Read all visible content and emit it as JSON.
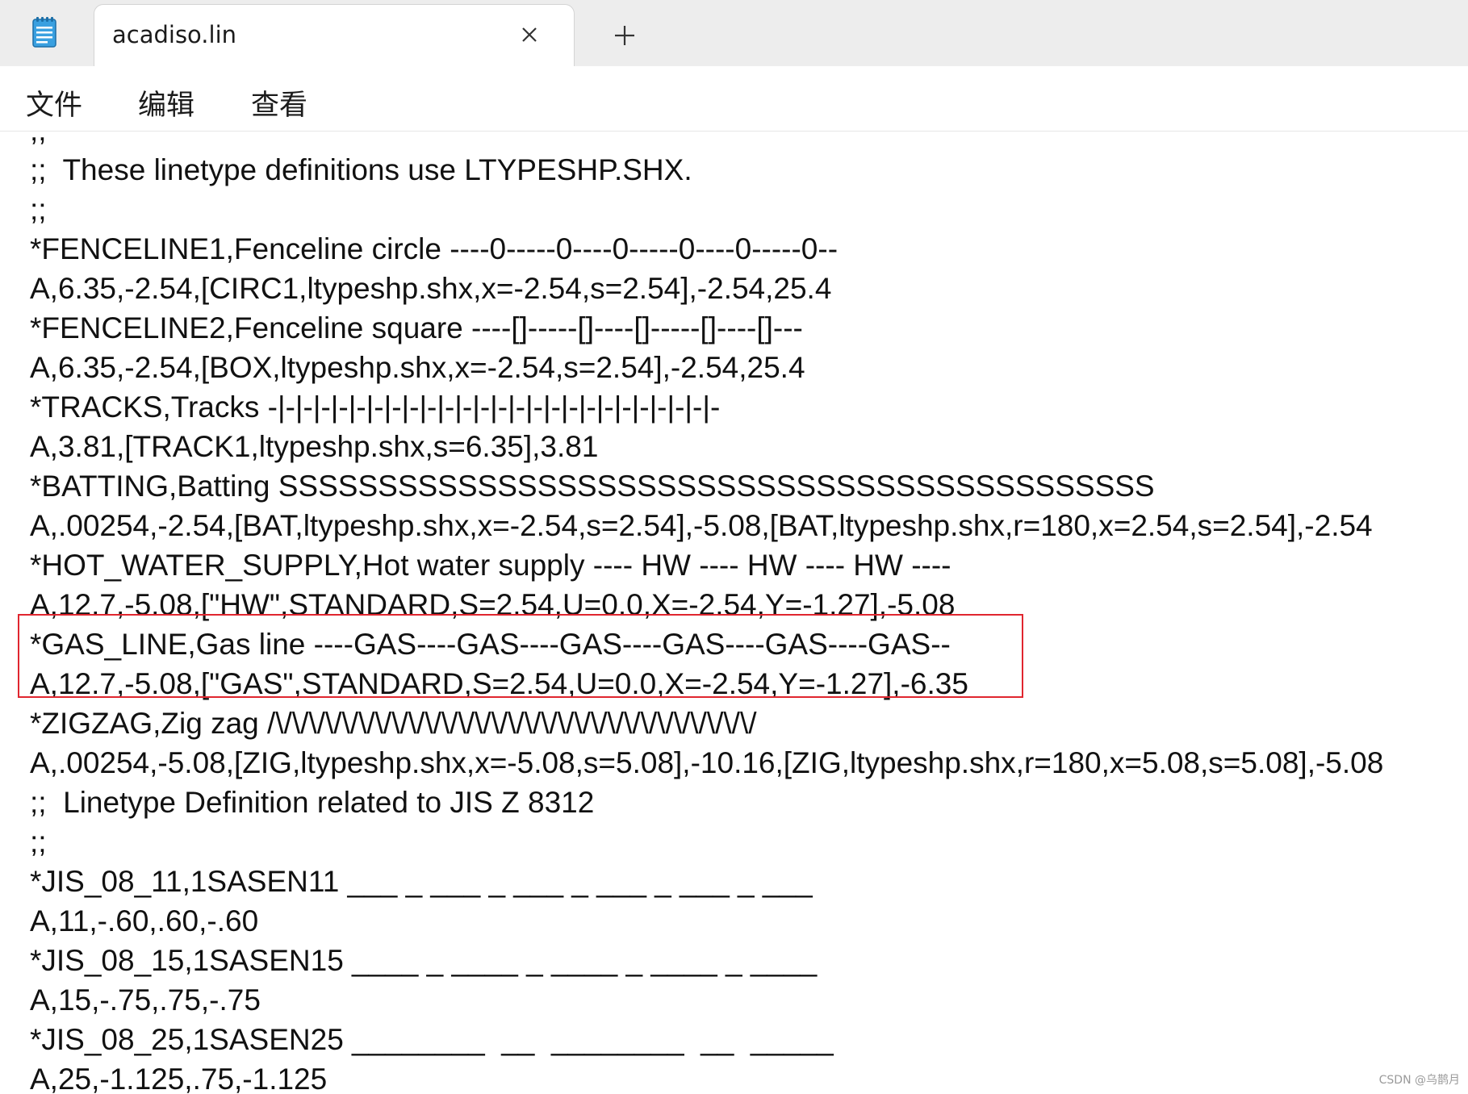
{
  "tab": {
    "title": "acadiso.lin",
    "close_icon": "close-icon",
    "new_tab_icon": "plus-icon"
  },
  "app_icon": "notepad-icon",
  "menu": {
    "file": "文件",
    "edit": "编辑",
    "view": "查看"
  },
  "editor": {
    "lines": [
      ";;",
      ";;  These linetype definitions use LTYPESHP.SHX.",
      ";;",
      "*FENCELINE1,Fenceline circle ----0-----0----0-----0----0-----0--",
      "A,6.35,-2.54,[CIRC1,ltypeshp.shx,x=-2.54,s=2.54],-2.54,25.4",
      "*FENCELINE2,Fenceline square ----[]-----[]----[]-----[]----[]---",
      "A,6.35,-2.54,[BOX,ltypeshp.shx,x=-2.54,s=2.54],-2.54,25.4",
      "*TRACKS,Tracks -|-|-|-|-|-|-|-|-|-|-|-|-|-|-|-|-|-|-|-|-|-|-|-|-|-",
      "A,3.81,[TRACK1,ltypeshp.shx,s=6.35],3.81",
      "*BATTING,Batting SSSSSSSSSSSSSSSSSSSSSSSSSSSSSSSSSSSSSSSSSSSS",
      "A,.00254,-2.54,[BAT,ltypeshp.shx,x=-2.54,s=2.54],-5.08,[BAT,ltypeshp.shx,r=180,x=2.54,s=2.54],-2.54",
      "*HOT_WATER_SUPPLY,Hot water supply ---- HW ---- HW ---- HW ----",
      "A,12.7,-5.08,[\"HW\",STANDARD,S=2.54,U=0.0,X=-2.54,Y=-1.27],-5.08",
      "*GAS_LINE,Gas line ----GAS----GAS----GAS----GAS----GAS----GAS--",
      "A,12.7,-5.08,[\"GAS\",STANDARD,S=2.54,U=0.0,X=-2.54,Y=-1.27],-6.35",
      "*ZIGZAG,Zig zag /\\/\\/\\/\\/\\/\\/\\/\\/\\/\\/\\/\\/\\/\\/\\/\\/\\/\\/\\/\\/\\/\\/\\/\\/\\/\\/\\/\\/\\/",
      "A,.00254,-5.08,[ZIG,ltypeshp.shx,x=-5.08,s=5.08],-10.16,[ZIG,ltypeshp.shx,r=180,x=5.08,s=5.08],-5.08",
      ";;  Linetype Definition related to JIS Z 8312",
      ";;",
      "*JIS_08_11,1SASEN11 ___ _ ___ _ ___ _ ___ _ ___ _ ___",
      "A,11,-.60,.60,-.60",
      "*JIS_08_15,1SASEN15 ____ _ ____ _ ____ _ ____ _ ____",
      "A,15,-.75,.75,-.75",
      "*JIS_08_25,1SASEN25 ________  __  ________  __  _____",
      "A,25,-1.125,.75,-1.125"
    ],
    "highlight_color": "#e0262f"
  },
  "watermark": "CSDN @乌鹊月"
}
